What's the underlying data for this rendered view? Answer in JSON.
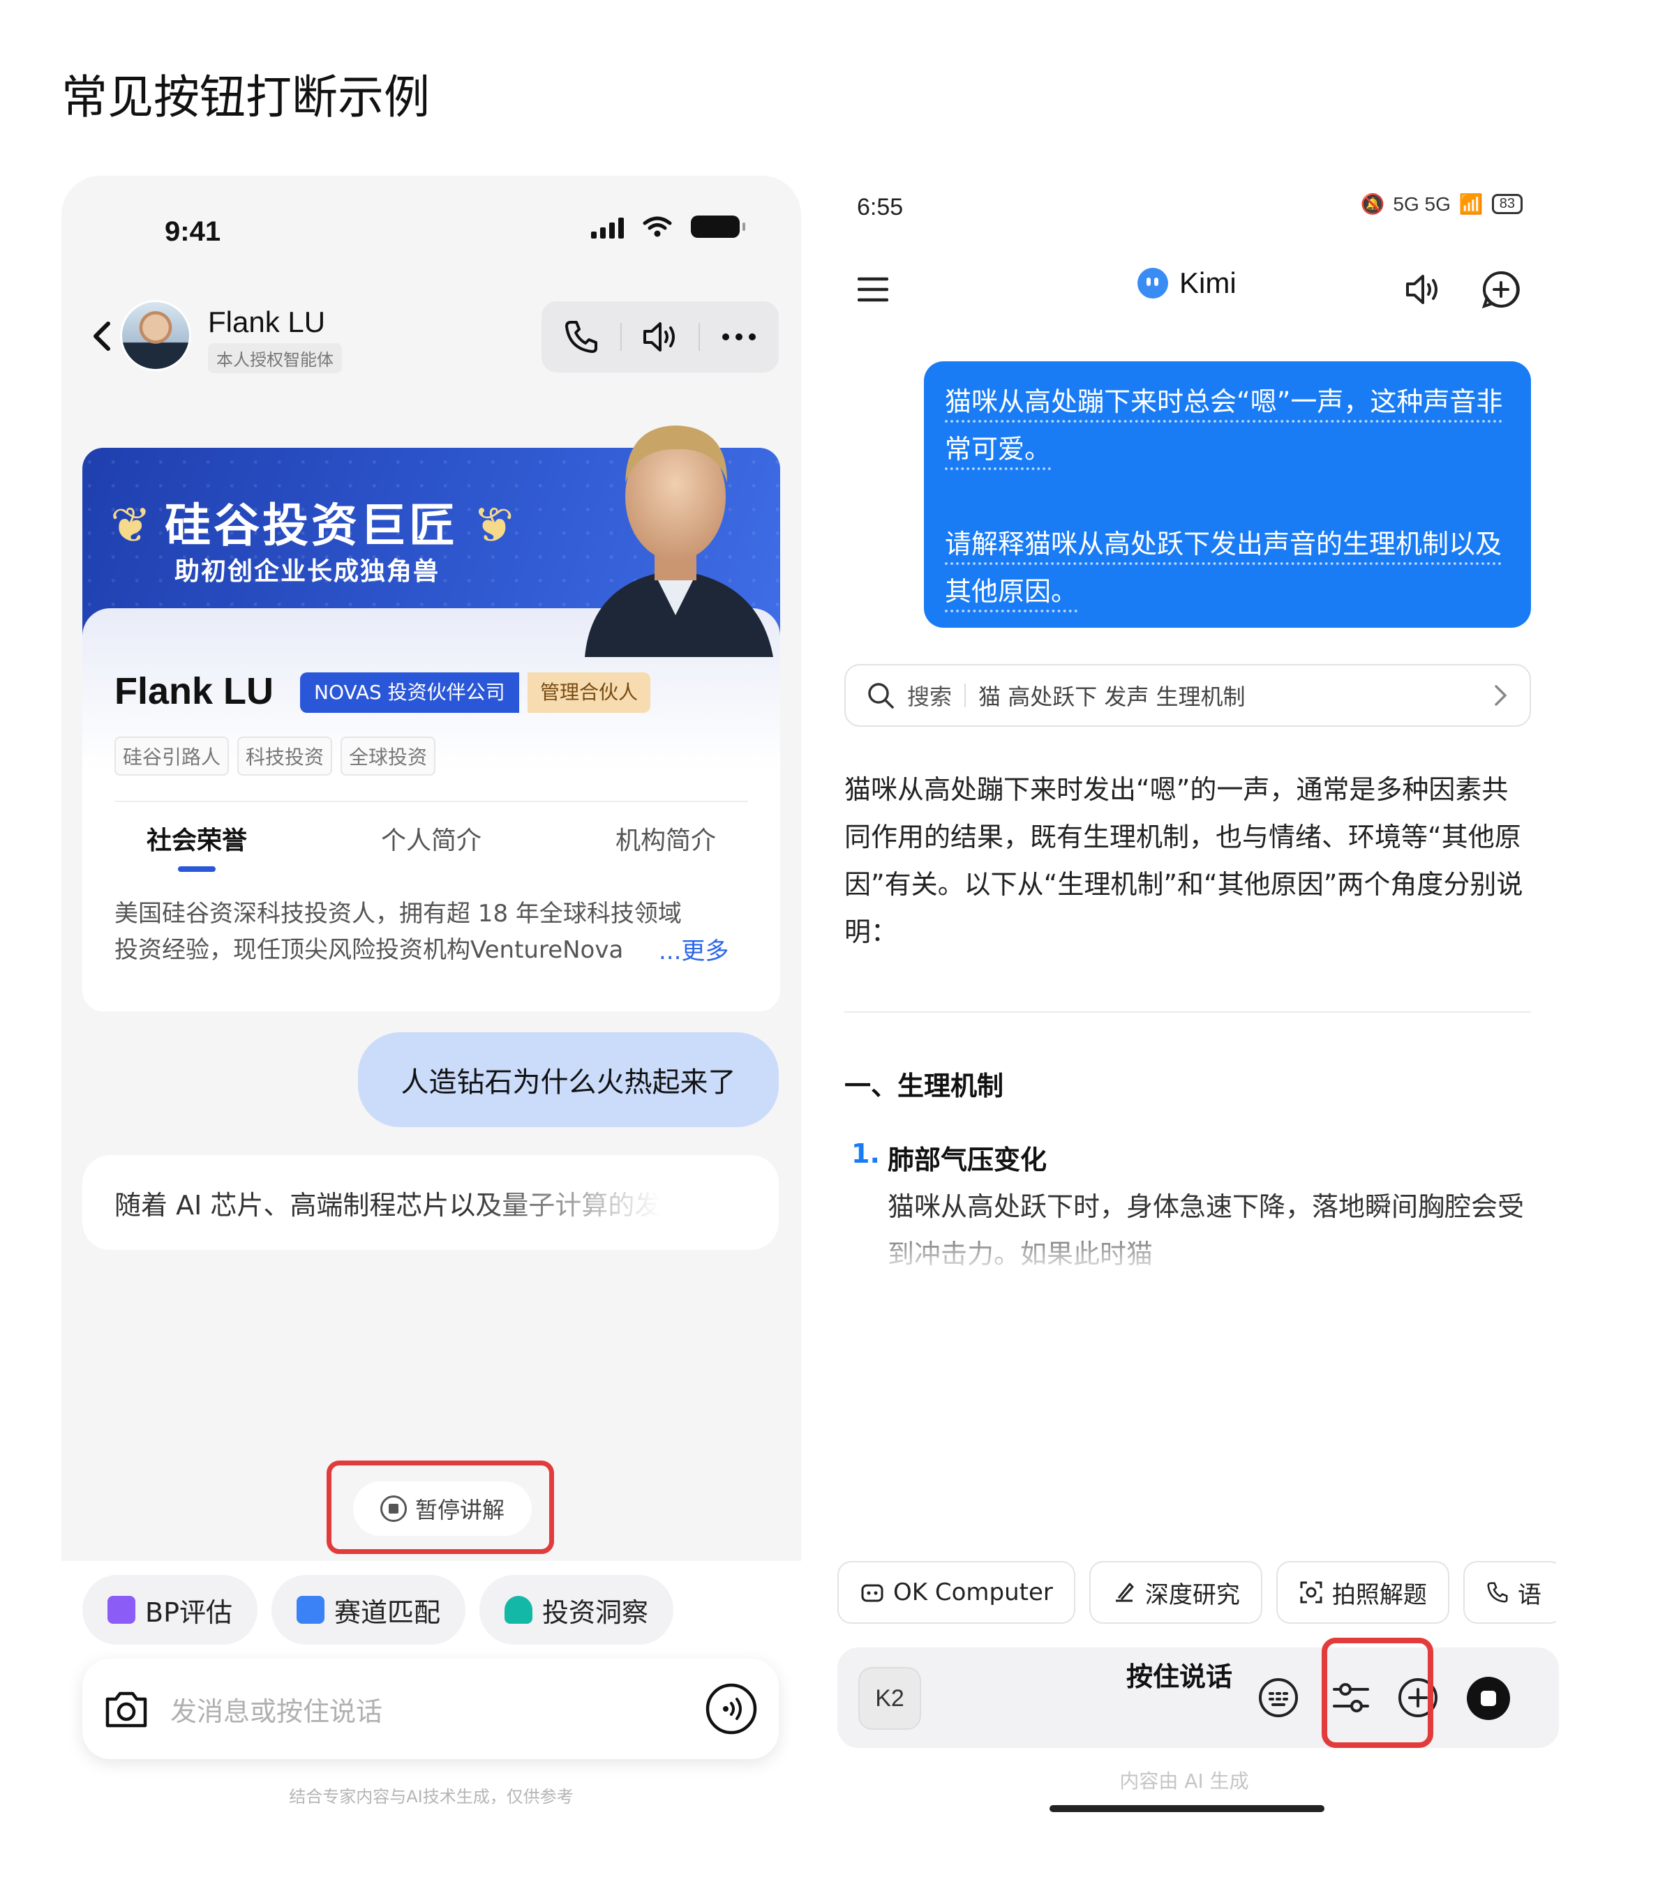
{
  "page": {
    "title": "常见按钮打断示例"
  },
  "left_app": {
    "status": {
      "time": "9:41"
    },
    "header": {
      "name": "Flank LU",
      "badge": "本人授权智能体"
    },
    "banner": {
      "title": "硅谷投资巨匠",
      "subtitle": "助初创企业长成独角兽"
    },
    "profile": {
      "name": "Flank LU",
      "company_tag": "NOVAS 投资伙伴公司",
      "role_tag": "管理合伙人",
      "chips": [
        "硅谷引路人",
        "科技投资",
        "全球投资"
      ],
      "tabs": [
        {
          "label": "社会荣誉",
          "active": true
        },
        {
          "label": "个人简介",
          "active": false
        },
        {
          "label": "机构简介",
          "active": false
        }
      ],
      "desc_line1": "美国硅谷资深科技投资人，拥有超 18 年全球科技领域",
      "desc_line2": "投资经验，现任顶尖风险投资机构VentureNova",
      "more": "...更多"
    },
    "chat": {
      "user_msg": "人造钻石为什么火热起来了",
      "ai_msg": "随着 AI 芯片、高端制程芯片以及量子计算的发"
    },
    "pause_button": "暂停讲解",
    "quick_actions": [
      {
        "label": "BP评估",
        "color": "#8b5cf6"
      },
      {
        "label": "赛道匹配",
        "color": "#3b82f6"
      },
      {
        "label": "投资洞察",
        "color": "#14b8a6"
      }
    ],
    "input_placeholder": "发消息或按住说话",
    "disclaimer": "结合专家内容与AI技术生成，仅供参考",
    "accent": "#2a56d8",
    "highlight_color": "#e23b3b"
  },
  "right_app": {
    "status": {
      "time": "6:55",
      "network": "5G 5G",
      "battery": "83"
    },
    "header": {
      "brand": "Kimi"
    },
    "user_msg": {
      "line1": "猫咪从高处蹦下来时总会“嗯”一声，这种声音非常可爱。",
      "line2": "请解释猫咪从高处跃下发出声音的生理机制以及其他原因。"
    },
    "search": {
      "label": "搜索",
      "query": "猫 高处跃下 发声 生理机制"
    },
    "answer_intro": "猫咪从高处蹦下来时发出“嗯”的一声，通常是多种因素共同作用的结果，既有生理机制，也与情绪、环境等“其他原因”有关。以下从“生理机制”和“其他原因”两个角度分别说明：",
    "section_heading": "一、生理机制",
    "list_item": {
      "number": "1.",
      "title": "肺部气压变化",
      "body": "猫咪从高处跃下时，身体急速下降，落地瞬间胸腔会受到冲击力。如果此时猫"
    },
    "chips": [
      "OK Computer",
      "深度研究",
      "拍照解题",
      "语"
    ],
    "input": {
      "model": "K2",
      "push_to_talk": "按住说话"
    },
    "disclaimer": "内容由 AI 生成",
    "accent": "#1a7cf5"
  }
}
